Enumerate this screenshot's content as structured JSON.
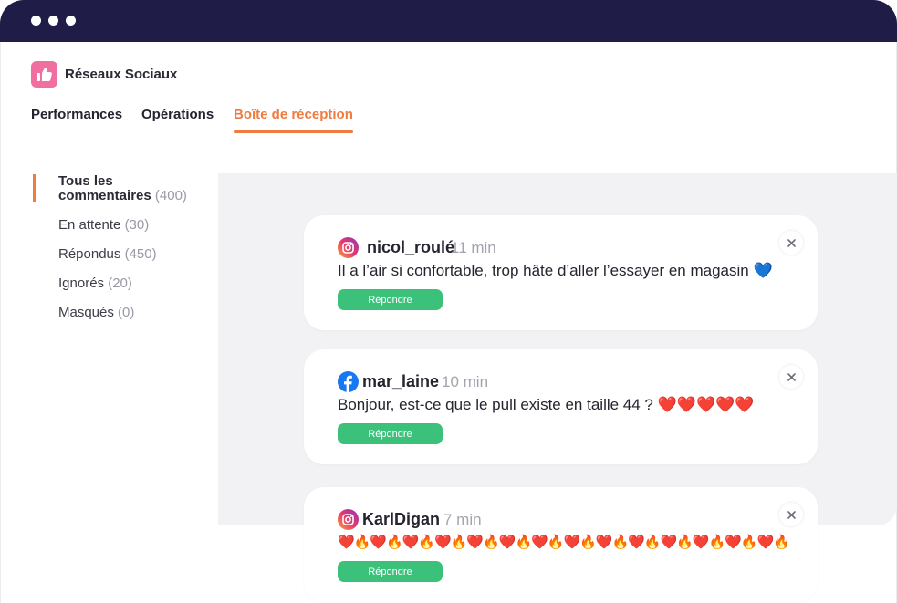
{
  "app": {
    "title": "Réseaux Sociaux",
    "logo_icon": "thumbs-up-icon",
    "logo_color": "#f06fa0"
  },
  "window": {
    "bar_color": "#1f1c47"
  },
  "tabs": [
    {
      "label": "Performances",
      "active": false
    },
    {
      "label": "Opérations",
      "active": false
    },
    {
      "label": "Boîte de réception",
      "active": true
    }
  ],
  "filters": [
    {
      "label": "Tous les commentaires",
      "count": "(400)",
      "active": true
    },
    {
      "label": "En attente",
      "count": "(30)",
      "active": false
    },
    {
      "label": "Répondus",
      "count": "(450)",
      "active": false
    },
    {
      "label": "Ignorés",
      "count": "(20)",
      "active": false
    },
    {
      "label": "Masqués",
      "count": "(0)",
      "active": false
    }
  ],
  "comments": [
    {
      "network": "instagram-icon",
      "author": "nicol_roulé",
      "time": "11 min",
      "message": "Il a l’air si confortable, trop hâte d’aller l’essayer en magasin 💙",
      "reply_label": "Répondre"
    },
    {
      "network": "facebook-icon",
      "author": "mar_laine",
      "time": "10 min",
      "message": "Bonjour, est-ce que le pull existe en taille 44 ? ❤️❤️❤️❤️❤️",
      "reply_label": "Répondre"
    },
    {
      "network": "instagram-icon",
      "author": "KarlDigan",
      "time": "7 min",
      "message": "❤️🔥❤️🔥❤️🔥❤️🔥❤️🔥❤️🔥❤️🔥❤️🔥❤️🔥❤️🔥❤️🔥❤️🔥❤️🔥❤️🔥",
      "reply_label": "Répondre"
    }
  ],
  "colors": {
    "accent": "#f07b3f",
    "reply_button": "#3cc17b",
    "panel_bg": "#f2f2f4"
  }
}
